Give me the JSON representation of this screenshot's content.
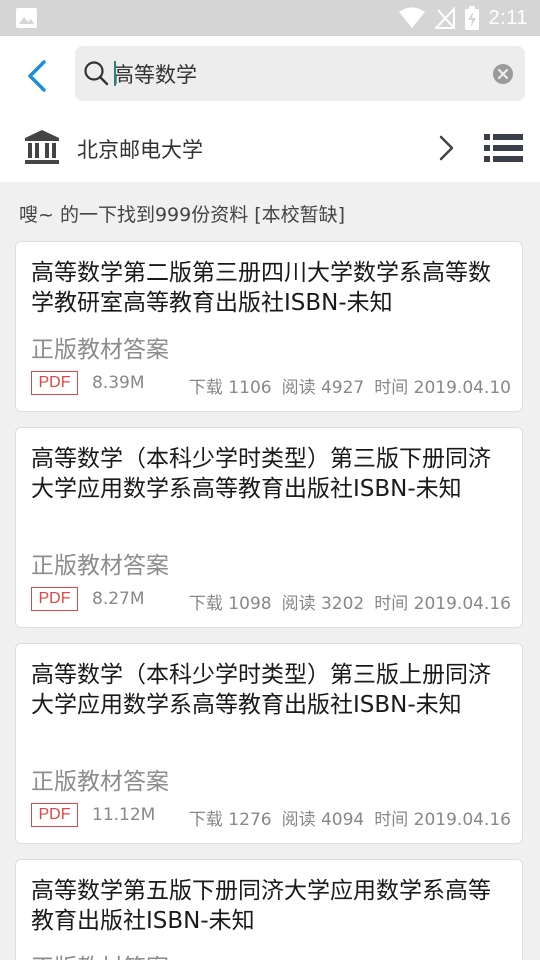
{
  "status_bar": {
    "time": "2:11"
  },
  "search": {
    "query": "高等数学"
  },
  "school": {
    "name": "北京邮电大学"
  },
  "result_summary": "嗖~ 的一下找到999份资料 [本校暂缺]",
  "results": [
    {
      "title": "高等数学第二版第三册四川大学数学系高等数学教研室高等教育出版社ISBN-未知",
      "subtitle": "正版教材答案",
      "file_type": "PDF",
      "size": "8.39M",
      "downloads": "下载 1106",
      "reads": "阅读 4927",
      "time": "时间 2019.04.10"
    },
    {
      "title": "高等数学（本科少学时类型）第三版下册同济大学应用数学系高等教育出版社ISBN-未知",
      "subtitle": "正版教材答案",
      "file_type": "PDF",
      "size": "8.27M",
      "downloads": "下载 1098",
      "reads": "阅读 3202",
      "time": "时间 2019.04.16"
    },
    {
      "title": "高等数学（本科少学时类型）第三版上册同济大学应用数学系高等教育出版社ISBN-未知",
      "subtitle": "正版教材答案",
      "file_type": "PDF",
      "size": "11.12M",
      "downloads": "下载 1276",
      "reads": "阅读 4094",
      "time": "时间 2019.04.16"
    },
    {
      "title": "高等数学第五版下册同济大学应用数学系高等教育出版社ISBN-未知",
      "subtitle": "正版教材答案"
    }
  ],
  "colors": {
    "accent": "#1a8fd9",
    "pdf_badge": "#e54545",
    "caret": "#26857a"
  }
}
